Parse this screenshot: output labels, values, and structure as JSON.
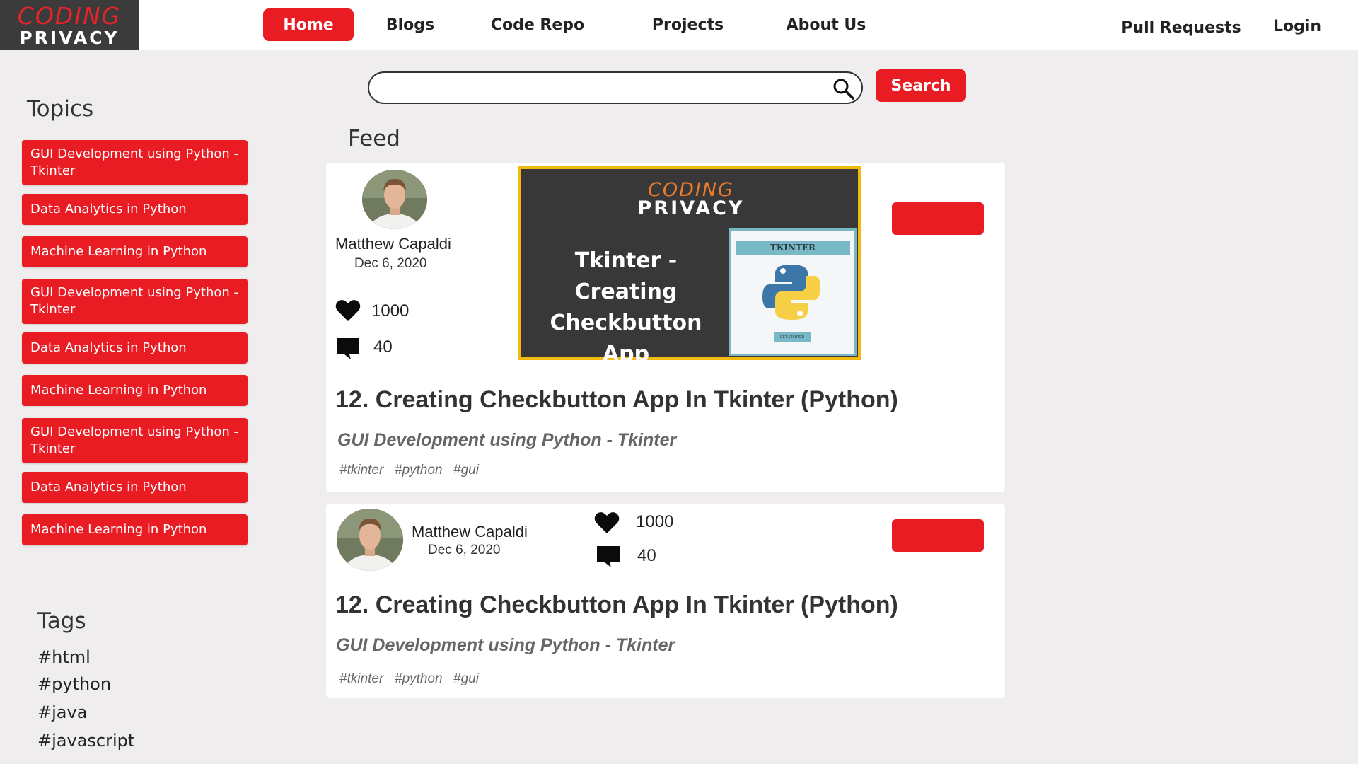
{
  "brand": {
    "line1": "CODING",
    "line2": "PRIVACY"
  },
  "nav": {
    "items": [
      {
        "label": "Home",
        "active": true
      },
      {
        "label": "Blogs"
      },
      {
        "label": "Code Repo"
      },
      {
        "label": "Projects"
      },
      {
        "label": "About Us"
      }
    ],
    "right": [
      {
        "label": "Pull Requests"
      },
      {
        "label": "Login"
      }
    ]
  },
  "search": {
    "placeholder": "",
    "value": "",
    "button_label": "Search"
  },
  "sidebar": {
    "topics_title": "Topics",
    "topics": [
      "GUI Development using Python - Tkinter",
      "Data Analytics in Python",
      "Machine Learning in Python",
      "GUI Development using Python - Tkinter",
      "Data Analytics in Python",
      "Machine Learning in Python",
      "GUI Development using Python - Tkinter",
      "Data Analytics in Python",
      "Machine Learning in Python"
    ],
    "tags_title": "Tags",
    "tags": [
      "#html",
      "#python",
      "#java",
      "#javascript"
    ]
  },
  "feed": {
    "title": "Feed",
    "posts": [
      {
        "author": "Matthew Capaldi",
        "date": "Dec 6, 2020",
        "likes": "1000",
        "comments": "40",
        "title": "12. Creating Checkbutton App In Tkinter (Python)",
        "topic": "GUI Development using Python - Tkinter",
        "tags": [
          "#tkinter",
          "#python",
          "#gui"
        ],
        "thumbnail": {
          "brand_line1": "CODING",
          "brand_line2": "PRIVACY",
          "heading_line1": "Tkinter -",
          "heading_line2": "Creating Checkbutton",
          "heading_line3": "App",
          "window_title": "TKINTER",
          "window_button": "GET STARTED"
        }
      },
      {
        "author": "Matthew Capaldi",
        "date": "Dec 6, 2020",
        "likes": "1000",
        "comments": "40",
        "title": "12. Creating Checkbutton App In Tkinter (Python)",
        "topic": "GUI Development using Python - Tkinter",
        "tags": [
          "#tkinter",
          "#python",
          "#gui"
        ]
      }
    ]
  },
  "colors": {
    "accent": "#e91c24",
    "page_bg": "#efedee",
    "thumb_border": "#f2b90e"
  }
}
